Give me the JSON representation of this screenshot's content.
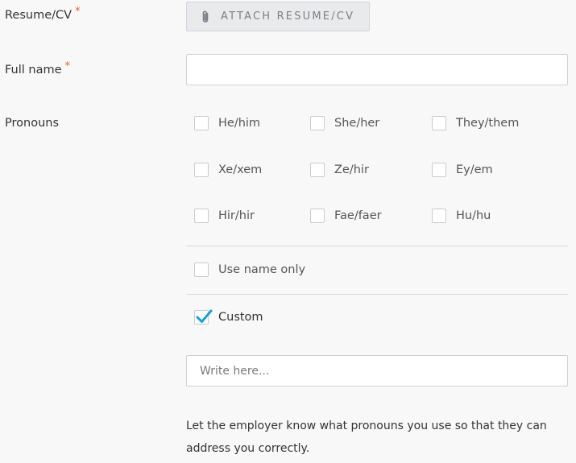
{
  "resume": {
    "label": "Resume/CV",
    "required_mark": "*",
    "button_label": "ATTACH RESUME/CV"
  },
  "full_name": {
    "label": "Full name",
    "required_mark": "*",
    "value": "",
    "placeholder": ""
  },
  "pronouns": {
    "label": "Pronouns",
    "options": [
      {
        "label": "He/him",
        "checked": false
      },
      {
        "label": "She/her",
        "checked": false
      },
      {
        "label": "They/them",
        "checked": false
      },
      {
        "label": "Xe/xem",
        "checked": false
      },
      {
        "label": "Ze/hir",
        "checked": false
      },
      {
        "label": "Ey/em",
        "checked": false
      },
      {
        "label": "Hir/hir",
        "checked": false
      },
      {
        "label": "Fae/faer",
        "checked": false
      },
      {
        "label": "Hu/hu",
        "checked": false
      }
    ],
    "use_name_only": {
      "label": "Use name only",
      "checked": false
    },
    "custom": {
      "label": "Custom",
      "checked": true
    },
    "custom_input": {
      "value": "",
      "placeholder": "Write here..."
    },
    "help_text": "Let the employer know what pronouns you use so that they can address you correctly."
  },
  "colors": {
    "required": "#ea5a2f",
    "check": "#1a9fd9"
  }
}
